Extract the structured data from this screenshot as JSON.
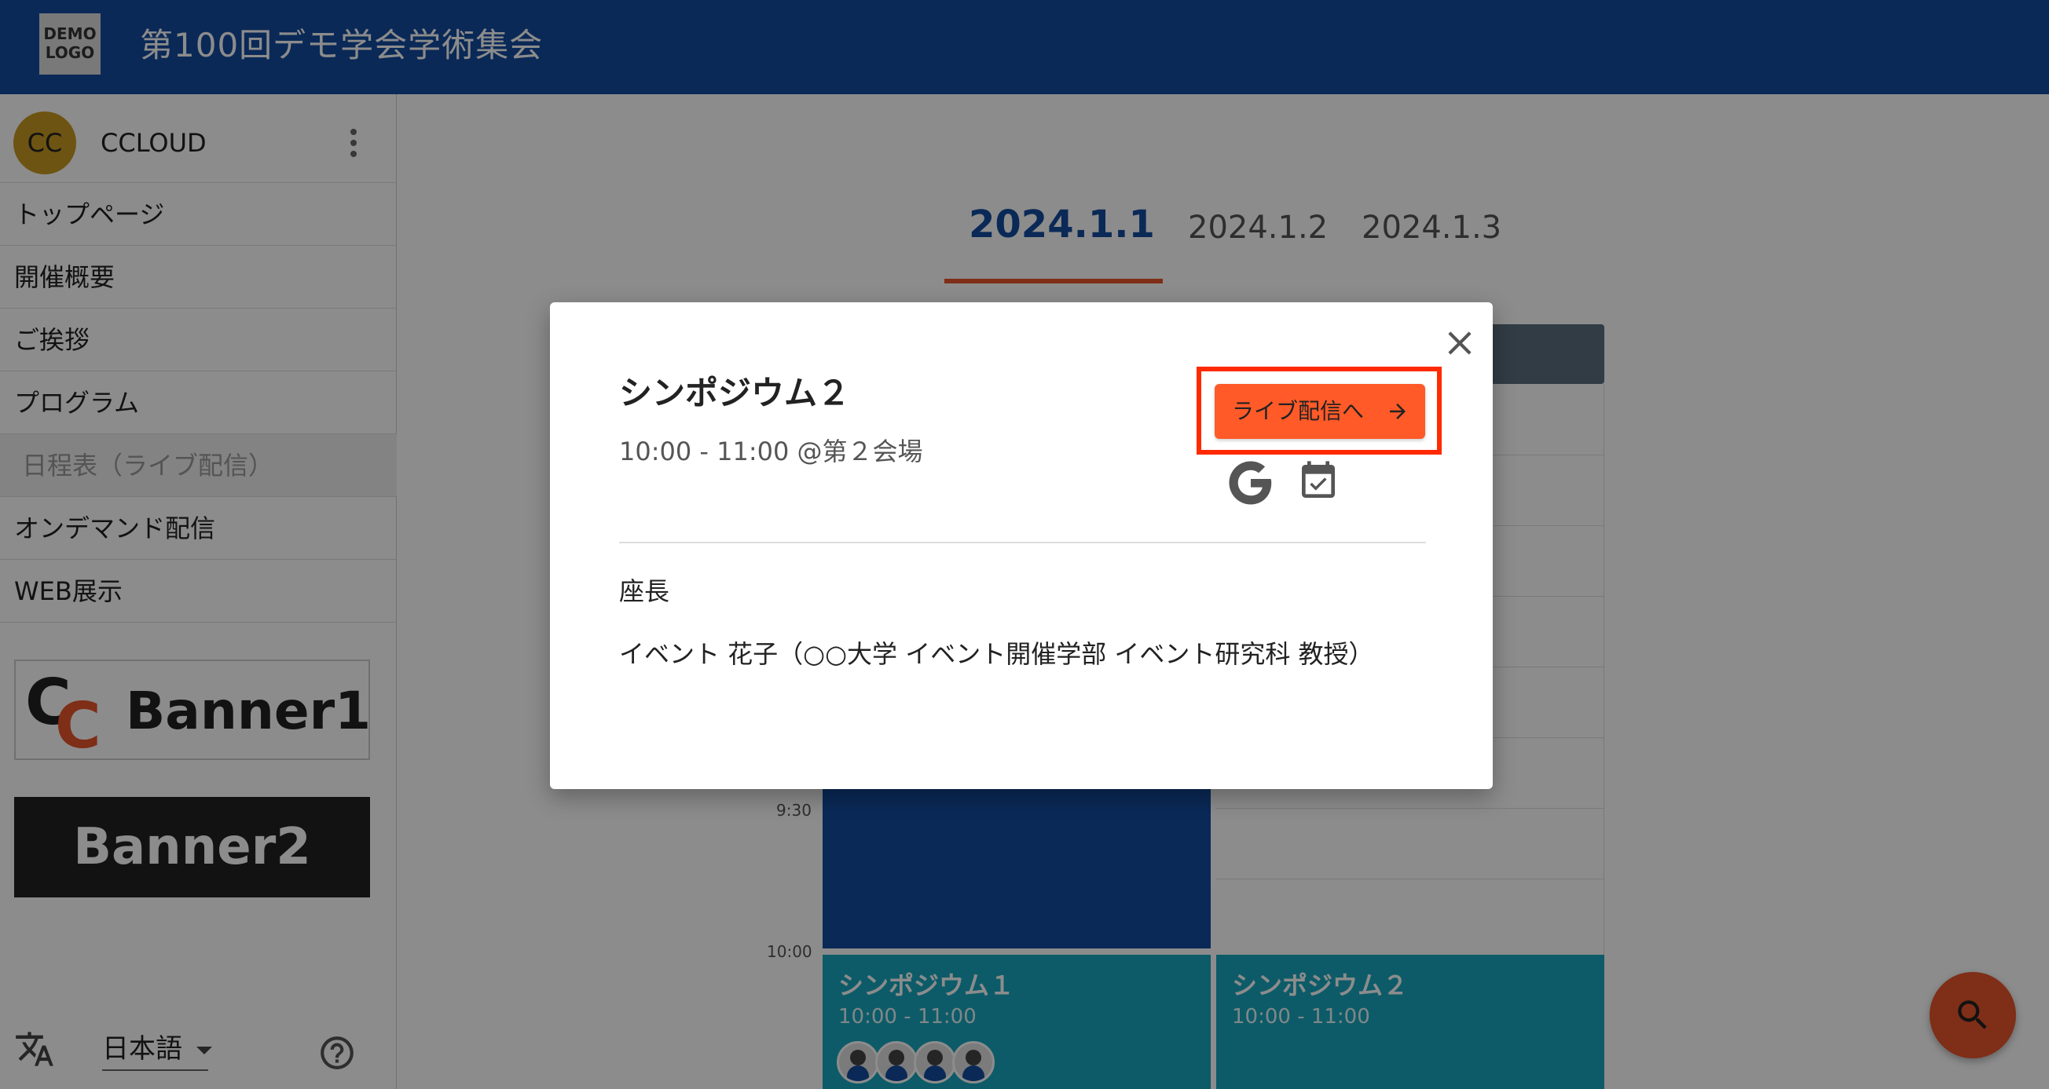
{
  "header": {
    "logo_text": "DEMO LOGO",
    "site_title": "第100回デモ学会学術集会"
  },
  "sidebar": {
    "user": {
      "initials": "CC",
      "name": "CCLOUD"
    },
    "items": [
      {
        "label": "トップページ"
      },
      {
        "label": "開催概要"
      },
      {
        "label": "ご挨拶"
      },
      {
        "label": "プログラム"
      },
      {
        "label": "日程表（ライブ配信）",
        "active": true
      },
      {
        "label": "オンデマンド配信"
      },
      {
        "label": "WEB展示"
      }
    ],
    "banners": [
      {
        "text": "Banner1",
        "logo_letters": "CC"
      },
      {
        "text": "Banner2"
      }
    ],
    "language": "日本語"
  },
  "main": {
    "date_tabs": [
      {
        "label": "2024.1.1",
        "active": true
      },
      {
        "label": "2024.1.2"
      },
      {
        "label": "2024.1.3"
      }
    ],
    "time_labels": [
      "9:30",
      "10:00"
    ],
    "sessions": [
      {
        "title": "シンポジウム１",
        "time": "10:00 - 11:00",
        "speakers": 4
      },
      {
        "title": "シンポジウム２",
        "time": "10:00 - 11:00",
        "speakers": 0
      }
    ]
  },
  "modal": {
    "title": "シンポジウム２",
    "subtitle": "10:00 - 11:00 @第２会場",
    "live_button_label": "ライブ配信へ",
    "chair_label": "座長",
    "chair_person": "イベント 花子（○○大学 イベント開催学部 イベント研究科 教授）"
  },
  "colors": {
    "header_bg": "#134c9e",
    "accent": "#e8542a",
    "live_button": "#ff5a28",
    "highlight": "#ff2a00",
    "session_teal": "#19a7bd",
    "session_dark": "#134c9e"
  }
}
